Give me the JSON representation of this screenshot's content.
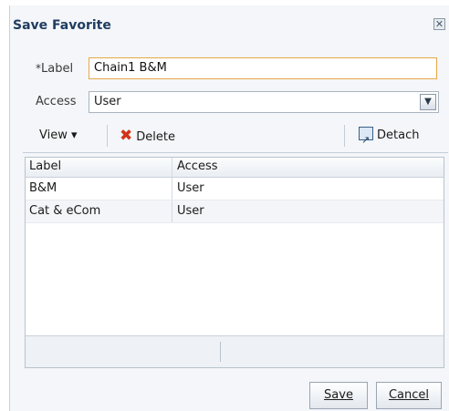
{
  "dialog": {
    "title": "Save Favorite",
    "close_glyph": "✕"
  },
  "form": {
    "required_marker": "*",
    "label_label": "Label",
    "label_value": "Chain1 B&M",
    "access_label": "Access",
    "access_value": "User"
  },
  "toolbar": {
    "view_label": "View ▾",
    "delete_label": "Delete",
    "detach_label": "Detach"
  },
  "table": {
    "columns": [
      "Label",
      "Access"
    ],
    "rows": [
      [
        "B&M",
        "User"
      ],
      [
        "Cat & eCom",
        "User"
      ]
    ]
  },
  "buttons": {
    "save_label": "Save",
    "cancel_label": "Cancel"
  },
  "colors": {
    "title_text": "#1f3c5f",
    "focused_border": "#e8a74a",
    "delete_icon": "#d3321a"
  }
}
